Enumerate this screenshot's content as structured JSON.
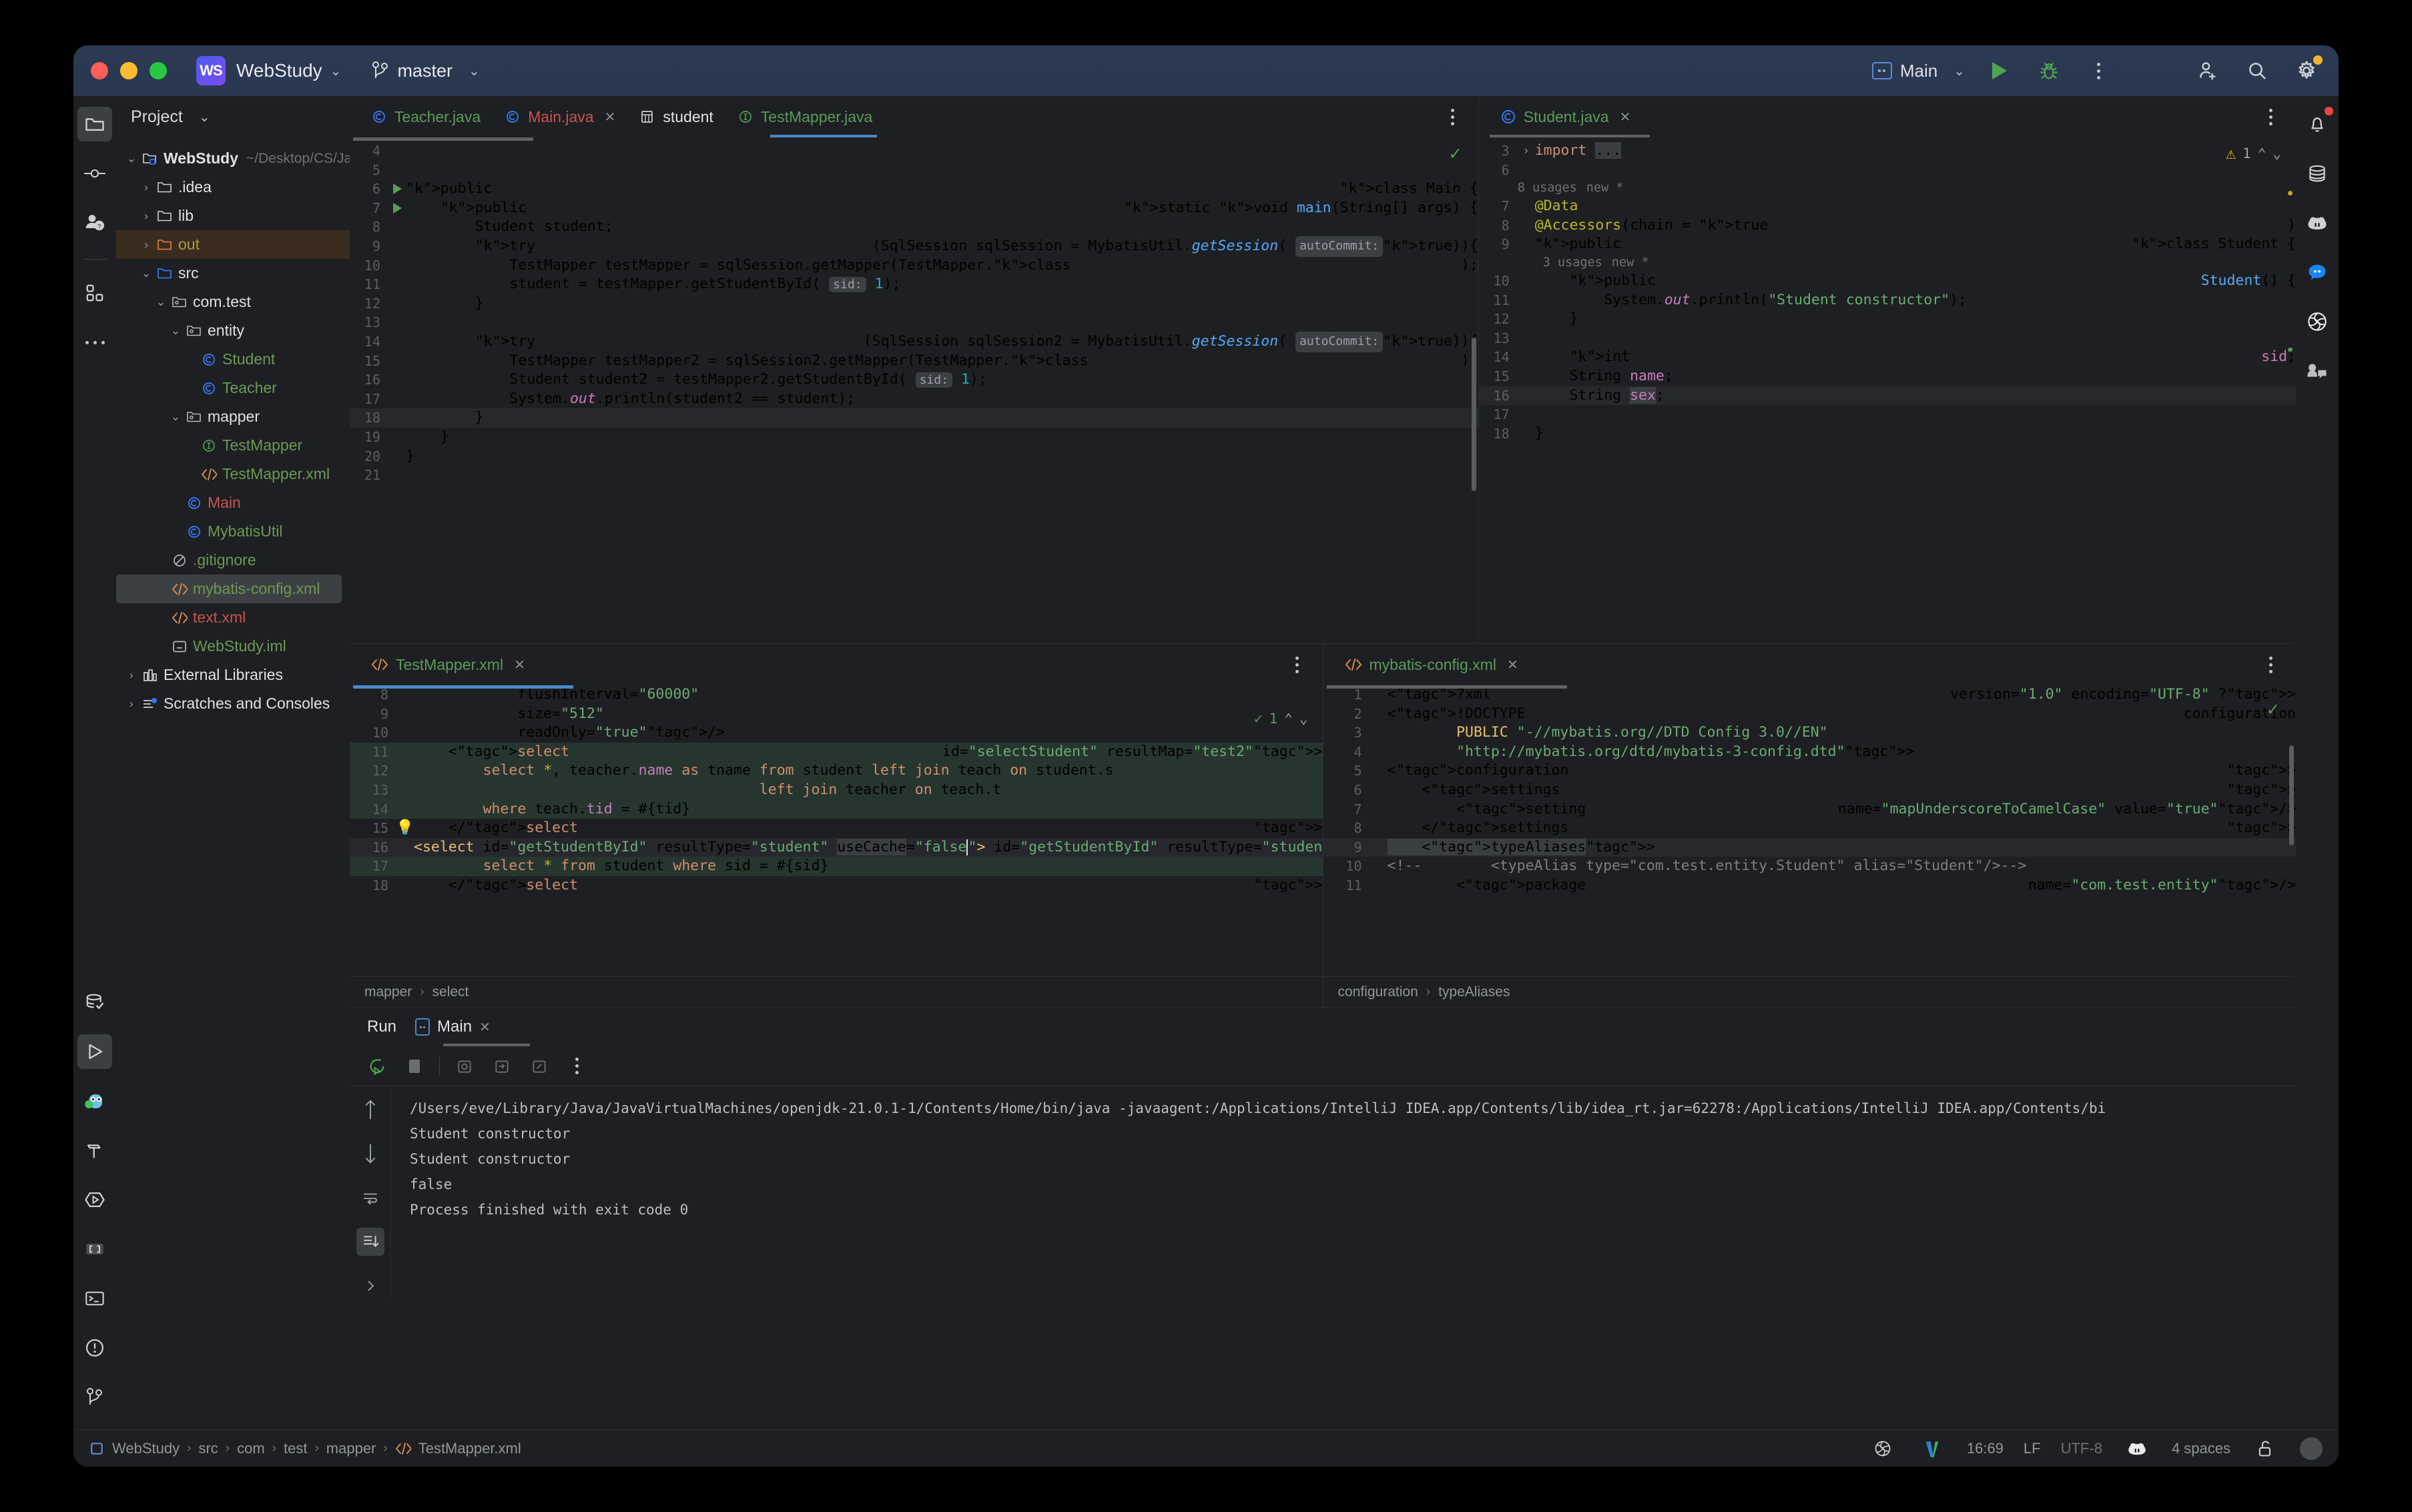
{
  "titlebar": {
    "app_badge": "WS",
    "project": "WebStudy",
    "branch": "master",
    "run_config": "Main",
    "chevron": "⌄"
  },
  "project_panel": {
    "title": "Project",
    "tree": [
      {
        "label": "WebStudy",
        "path": "~/Desktop/CS/Jav",
        "indent": 0,
        "arrow": "⌄",
        "icon": "module-folder-icon",
        "color": "white",
        "bold": true,
        "state": "none"
      },
      {
        "label": ".idea",
        "path": "",
        "indent": 1,
        "arrow": "›",
        "icon": "folder-icon",
        "color": "white",
        "bold": false,
        "state": "none"
      },
      {
        "label": "lib",
        "path": "",
        "indent": 1,
        "arrow": "›",
        "icon": "folder-icon",
        "color": "white",
        "bold": false,
        "state": "none"
      },
      {
        "label": "out",
        "path": "",
        "indent": 1,
        "arrow": "›",
        "icon": "folder-orange-icon",
        "color": "olive",
        "bold": false,
        "state": "sel-out"
      },
      {
        "label": "src",
        "path": "",
        "indent": 1,
        "arrow": "⌄",
        "icon": "folder-blue-icon",
        "color": "white",
        "bold": false,
        "state": "none"
      },
      {
        "label": "com.test",
        "path": "",
        "indent": 2,
        "arrow": "⌄",
        "icon": "package-icon",
        "color": "white",
        "bold": false,
        "state": "none"
      },
      {
        "label": "entity",
        "path": "",
        "indent": 3,
        "arrow": "⌄",
        "icon": "package-icon",
        "color": "white",
        "bold": false,
        "state": "none"
      },
      {
        "label": "Student",
        "path": "",
        "indent": 4,
        "arrow": "",
        "icon": "class-icon",
        "color": "green",
        "bold": false,
        "state": "none"
      },
      {
        "label": "Teacher",
        "path": "",
        "indent": 4,
        "arrow": "",
        "icon": "class-icon",
        "color": "green",
        "bold": false,
        "state": "none"
      },
      {
        "label": "mapper",
        "path": "",
        "indent": 3,
        "arrow": "⌄",
        "icon": "package-icon",
        "color": "white",
        "bold": false,
        "state": "none"
      },
      {
        "label": "TestMapper",
        "path": "",
        "indent": 4,
        "arrow": "",
        "icon": "interface-icon",
        "color": "green",
        "bold": false,
        "state": "none"
      },
      {
        "label": "TestMapper.xml",
        "path": "",
        "indent": 4,
        "arrow": "",
        "icon": "xml-icon",
        "color": "green",
        "bold": false,
        "state": "none"
      },
      {
        "label": "Main",
        "path": "",
        "indent": 3,
        "arrow": "",
        "icon": "class-icon",
        "color": "red",
        "bold": false,
        "state": "none"
      },
      {
        "label": "MybatisUtil",
        "path": "",
        "indent": 3,
        "arrow": "",
        "icon": "class-icon",
        "color": "green",
        "bold": false,
        "state": "none"
      },
      {
        "label": ".gitignore",
        "path": "",
        "indent": 2,
        "arrow": "",
        "icon": "gitignore-icon",
        "color": "green",
        "bold": false,
        "state": "none"
      },
      {
        "label": "mybatis-config.xml",
        "path": "",
        "indent": 2,
        "arrow": "",
        "icon": "xml-icon",
        "color": "green",
        "bold": false,
        "state": "sel-grey"
      },
      {
        "label": "text.xml",
        "path": "",
        "indent": 2,
        "arrow": "",
        "icon": "xml-icon",
        "color": "red",
        "bold": false,
        "state": "none"
      },
      {
        "label": "WebStudy.iml",
        "path": "",
        "indent": 2,
        "arrow": "",
        "icon": "iml-icon",
        "color": "green",
        "bold": false,
        "state": "none"
      },
      {
        "label": "External Libraries",
        "path": "",
        "indent": 0,
        "arrow": "›",
        "icon": "libraries-icon",
        "color": "white",
        "bold": false,
        "state": "none"
      },
      {
        "label": "Scratches and Consoles",
        "path": "",
        "indent": 0,
        "arrow": "›",
        "icon": "scratches-icon",
        "color": "white",
        "bold": false,
        "state": "none"
      }
    ]
  },
  "main_editor": {
    "tabs": [
      {
        "label": "Teacher.java",
        "icon": "class-icon",
        "color": "green",
        "active": false,
        "closable": false
      },
      {
        "label": "Main.java",
        "icon": "class-icon",
        "color": "red",
        "active": true,
        "closable": true
      },
      {
        "label": "student",
        "icon": "table-icon",
        "color": "white",
        "active": false,
        "closable": false
      },
      {
        "label": "TestMapper.java",
        "icon": "interface-icon",
        "color": "green",
        "active": false,
        "closable": false
      }
    ],
    "lines": [
      {
        "no": "4",
        "text": ""
      },
      {
        "no": "5",
        "text": ""
      },
      {
        "no": "6",
        "text": "public class Main {",
        "run": true
      },
      {
        "no": "7",
        "text": "    public static void main(String[] args) {",
        "run": true
      },
      {
        "no": "8",
        "text": "        Student student;"
      },
      {
        "no": "9",
        "text": "        try (SqlSession sqlSession = MybatisUtil.getSession( autoCommit: true)){"
      },
      {
        "no": "10",
        "text": "            TestMapper testMapper = sqlSession.getMapper(TestMapper.class);"
      },
      {
        "no": "11",
        "text": "            student = testMapper.getStudentById( sid: 1);"
      },
      {
        "no": "12",
        "text": "        }"
      },
      {
        "no": "13",
        "text": ""
      },
      {
        "no": "14",
        "text": "        try (SqlSession sqlSession2 = MybatisUtil.getSession( autoCommit: true)){"
      },
      {
        "no": "15",
        "text": "            TestMapper testMapper2 = sqlSession2.getMapper(TestMapper.class);"
      },
      {
        "no": "16",
        "text": "            Student student2 = testMapper2.getStudentById( sid: 1);"
      },
      {
        "no": "17",
        "text": "            System.out.println(student2 == student);"
      },
      {
        "no": "18",
        "text": "        }",
        "highlight": true
      },
      {
        "no": "19",
        "text": "    }"
      },
      {
        "no": "20",
        "text": "}"
      },
      {
        "no": "21",
        "text": ""
      }
    ],
    "inspection_status": "✓"
  },
  "student_editor": {
    "tab": {
      "label": "Student.java",
      "icon": "class-icon"
    },
    "warning_count": "1",
    "usages_class": "8 usages",
    "usages_ctor": "3 usages",
    "new_marker": "new *",
    "lines": [
      {
        "no": "3",
        "text": "import ..."
      },
      {
        "no": "6",
        "text": ""
      },
      {
        "no": "7",
        "text": "@Data"
      },
      {
        "no": "8",
        "text": "@Accessors(chain = true)"
      },
      {
        "no": "9",
        "text": "public class Student {"
      },
      {
        "no": "10",
        "text": "    public Student() {"
      },
      {
        "no": "11",
        "text": "        System.out.println(\"Student constructor\");"
      },
      {
        "no": "12",
        "text": "    }"
      },
      {
        "no": "13",
        "text": ""
      },
      {
        "no": "14",
        "text": "    int sid;"
      },
      {
        "no": "15",
        "text": "    String name;"
      },
      {
        "no": "16",
        "text": "    String sex;",
        "highlight": true
      },
      {
        "no": "17",
        "text": ""
      },
      {
        "no": "18",
        "text": "}"
      }
    ]
  },
  "testmapper_editor": {
    "tab": {
      "label": "TestMapper.xml",
      "icon": "xml-icon"
    },
    "inspection_count": "1",
    "breadcrumbs": [
      "mapper",
      "select"
    ],
    "lines": [
      {
        "no": "8",
        "text": "            flushInterval=\"60000\""
      },
      {
        "no": "9",
        "text": "            size=\"512\""
      },
      {
        "no": "10",
        "text": "            readOnly=\"true\"/>"
      },
      {
        "no": "11",
        "text": "    <select id=\"selectStudent\" resultMap=\"test2\">"
      },
      {
        "no": "12",
        "text": "        select *, teacher.name as tname from student left join teach on student.s"
      },
      {
        "no": "13",
        "text": "                                        left join teacher on teach.t"
      },
      {
        "no": "14",
        "text": "        where teach.tid = #{tid}"
      },
      {
        "no": "15",
        "text": "    </select>",
        "bulb": true
      },
      {
        "no": "16",
        "text": "    <select id=\"getStudentById\" resultType=\"student\" useCache=\"false\">",
        "caret": true
      },
      {
        "no": "17",
        "text": "        select * from student where sid = #{sid}"
      },
      {
        "no": "18",
        "text": "    </select>"
      }
    ]
  },
  "mybatis_editor": {
    "tab": {
      "label": "mybatis-config.xml",
      "icon": "xml-icon"
    },
    "breadcrumbs": [
      "configuration",
      "typeAliases"
    ],
    "lines": [
      {
        "no": "1",
        "text": "<?xml version=\"1.0\" encoding=\"UTF-8\" ?>"
      },
      {
        "no": "2",
        "text": "<!DOCTYPE configuration"
      },
      {
        "no": "3",
        "text": "        PUBLIC \"-//mybatis.org//DTD Config 3.0//EN\""
      },
      {
        "no": "4",
        "text": "        \"http://mybatis.org/dtd/mybatis-3-config.dtd\">"
      },
      {
        "no": "5",
        "text": "<configuration>"
      },
      {
        "no": "6",
        "text": "    <settings>"
      },
      {
        "no": "7",
        "text": "        <setting name=\"mapUnderscoreToCamelCase\" value=\"true\"/>"
      },
      {
        "no": "8",
        "text": "    </settings>"
      },
      {
        "no": "9",
        "text": "    <typeAliases>",
        "highlight": true
      },
      {
        "no": "10",
        "text": "<!--        <typeAlias type=\"com.test.entity.Student\" alias=\"Student\"/>-->"
      },
      {
        "no": "11",
        "text": "        <package name=\"com.test.entity\"/>"
      }
    ]
  },
  "run_panel": {
    "label": "Run",
    "tab": "Main",
    "console": [
      "/Users/eve/Library/Java/JavaVirtualMachines/openjdk-21.0.1-1/Contents/Home/bin/java -javaagent:/Applications/IntelliJ IDEA.app/Contents/lib/idea_rt.jar=62278:/Applications/IntelliJ IDEA.app/Contents/bi",
      "Student constructor",
      "Student constructor",
      "false",
      "",
      "Process finished with exit code 0"
    ]
  },
  "status_bar": {
    "crumbs": [
      "WebStudy",
      "src",
      "com",
      "test",
      "mapper",
      "TestMapper.xml"
    ],
    "cursor_position": "16:69",
    "line_separator": "LF",
    "encoding": "UTF-8",
    "indent": "4 spaces"
  },
  "colors": {
    "accent_blue": "#4a88c7",
    "green": "#6aab73",
    "orange": "#cf8e6d",
    "warning": "#f0b232",
    "error": "#c75450"
  }
}
